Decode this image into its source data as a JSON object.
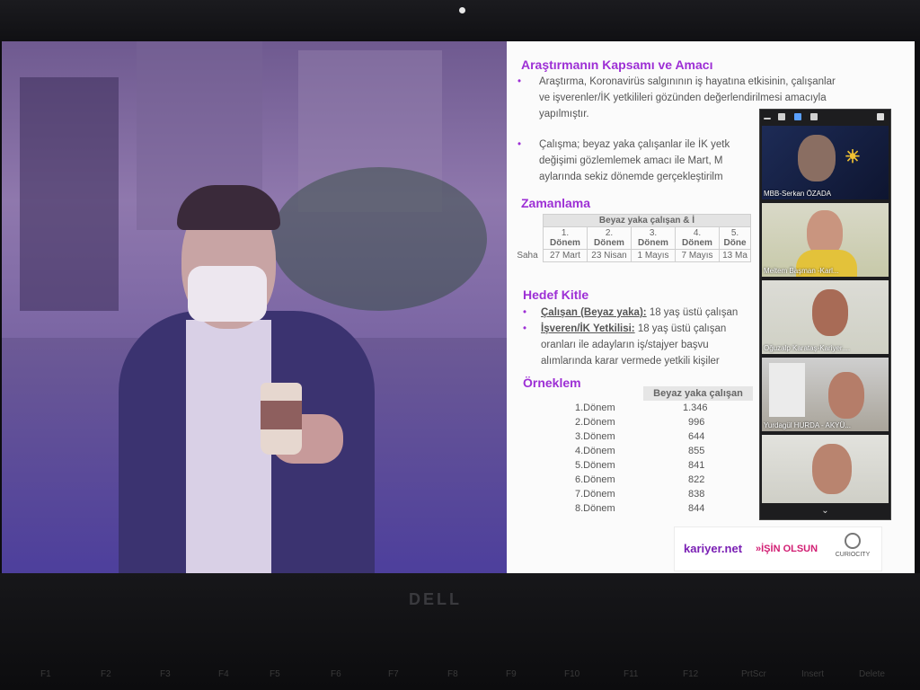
{
  "slide": {
    "title": "Araştırmanın Kapsamı ve Amacı",
    "bullet": "•",
    "p1_l1": "Araştırma, Koronavirüs salgınının iş hayatına etkisinin, çalışanlar",
    "p1_l2": "ve işverenler/İK yetkilileri gözünden değerlendirilmesi amacıyla",
    "p1_l3": "yapılmıştır.",
    "p2_l1": "Çalışma; beyaz yaka çalışanlar ile İK yetk",
    "p2_l2": "değişimi gözlemlemek amacı ile Mart, M",
    "p2_l3": "aylarında sekiz dönemde gerçekleştirilm",
    "zamanlama_title": "Zamanlama",
    "table_header": "Beyaz yaka çalışan & İ",
    "periods": [
      {
        "num": "1.",
        "label": "Dönem",
        "date": "27 Mart"
      },
      {
        "num": "2.",
        "label": "Dönem",
        "date": "23 Nisan"
      },
      {
        "num": "3.",
        "label": "Dönem",
        "date": "1 Mayıs"
      },
      {
        "num": "4.",
        "label": "Dönem",
        "date": "7 Mayıs"
      },
      {
        "num": "5.",
        "label": "Döne",
        "date": "13 Ma"
      }
    ],
    "saha_label": "Saha",
    "hedef_title": "Hedef Kitle",
    "hedef1_label": "Çalışan (Beyaz yaka):",
    "hedef1_text": " 18 yaş üstü çalışan",
    "hedef2_label": "İşveren/İK Yetkilisi:",
    "hedef2_text": " 18 yaş üstü çalışan",
    "hedef2_l2": "oranları ile adayların iş/stajyer başvu",
    "hedef2_l3": "alımlarında karar vermede yetkili kişiler",
    "orneklem_title": "Örneklem",
    "orneklem_header": "Beyaz yaka çalışan",
    "orneklem_rows": [
      {
        "donem": "1.Dönem",
        "value": "1.346"
      },
      {
        "donem": "2.Dönem",
        "value": "996"
      },
      {
        "donem": "3.Dönem",
        "value": "644"
      },
      {
        "donem": "4.Dönem",
        "value": "855"
      },
      {
        "donem": "5.Dönem",
        "value": "841"
      },
      {
        "donem": "6.Dönem",
        "value": "822"
      },
      {
        "donem": "7.Dönem",
        "value": "838"
      },
      {
        "donem": "8.Dönem",
        "value": "844"
      }
    ],
    "logos": {
      "kariyer": "kariyer.net",
      "isin": "»İŞİN OLSUN",
      "curio": "CURIOCITY"
    }
  },
  "zoom": {
    "participants": [
      {
        "name": "MBB-Serkan ÖZADA"
      },
      {
        "name": "Meltem Başman -Karl..."
      },
      {
        "name": "Oğuzalp Karataş-Kariyer...."
      },
      {
        "name": "Yurdagül HURDA - AKYÜ..."
      },
      {
        "name": ""
      }
    ],
    "chevron": "⌄"
  },
  "laptop": {
    "brand": "DELL",
    "keys": [
      "F1",
      "F2",
      "F3",
      "F4",
      "F5",
      "F6",
      "F7",
      "F8",
      "F9",
      "F10",
      "F11",
      "F12",
      "PrtScr",
      "Insert",
      "Delete"
    ]
  },
  "colors": {
    "accent": "#9d2fd5",
    "brand_pink": "#d21e73"
  }
}
